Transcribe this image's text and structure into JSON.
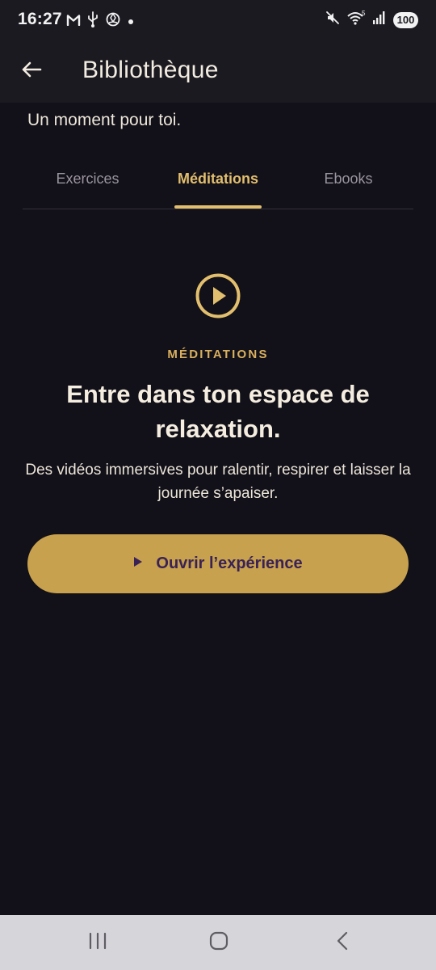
{
  "status_bar": {
    "time": "16:27",
    "battery": "100",
    "left_icons": [
      "gmail-icon",
      "usb-icon",
      "chatgpt-icon",
      "dot-icon"
    ],
    "right_icons": [
      "mute-icon",
      "wifi-icon",
      "signal-icon",
      "battery-icon"
    ]
  },
  "header": {
    "back_icon": "arrow-left-icon",
    "title": "Bibliothèque"
  },
  "subtitle": "Un moment pour toi.",
  "tabs": [
    {
      "label": "Exercices",
      "active": false
    },
    {
      "label": "Méditations",
      "active": true
    },
    {
      "label": "Ebooks",
      "active": false
    }
  ],
  "hero": {
    "icon": "play-circle-icon",
    "eyebrow": "MÉDITATIONS",
    "headline": "Entre dans ton espace de relaxation.",
    "description": "Des vidéos immersives pour ralentir, respirer et laisser la journée s’apaiser."
  },
  "cta": {
    "icon": "play-icon",
    "label": "Ouvrir l’expérience"
  },
  "system_nav": [
    "recents-icon",
    "home-icon",
    "back-icon"
  ],
  "colors": {
    "background": "#121018",
    "app_bar": "#1c1a21",
    "accent": "#e2bf6e",
    "button": "#c7a14d",
    "button_text": "#3a2256",
    "inactive_tab": "#9a95a0"
  }
}
